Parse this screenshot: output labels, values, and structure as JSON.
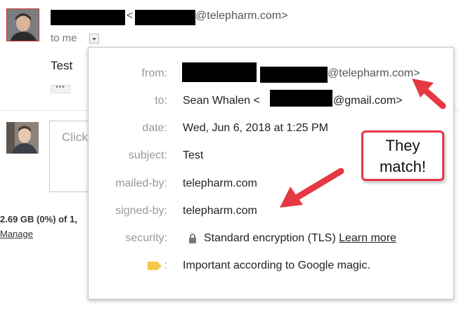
{
  "header": {
    "sender_domain": "@telepharm.com>",
    "sender_lt": "<",
    "to_me": "to me"
  },
  "message": {
    "body": "Test",
    "more_dots": "•••"
  },
  "reply": {
    "placeholder": "Click"
  },
  "storage": {
    "usage": "2.69 GB (0%) of 1,",
    "manage": "Manage"
  },
  "details": {
    "from_label": "from:",
    "from_domain": "@telepharm.com>",
    "to_label": "to:",
    "to_name": "Sean Whalen <",
    "to_domain": "@gmail.com>",
    "date_label": "date:",
    "date_value": "Wed, Jun 6, 2018 at 1:25 PM",
    "subject_label": "subject:",
    "subject_value": "Test",
    "mailed_by_label": "mailed-by:",
    "mailed_by_value": "telepharm.com",
    "signed_by_label": "signed-by:",
    "signed_by_value": "telepharm.com",
    "security_label": "security:",
    "security_value": "Standard encryption (TLS)",
    "learn_more": "Learn more",
    "importance_colon": ":",
    "importance_value": "Important according to Google magic."
  },
  "annotation": {
    "line1": "They",
    "line2": "match!"
  },
  "icons": {
    "lock": "lock-icon",
    "importance": "importance-marker-icon",
    "dropdown": "chevron-down-icon"
  },
  "colors": {
    "callout_border": "#e53744",
    "arrow": "#e53744",
    "importance_marker": "#f2c94c"
  }
}
